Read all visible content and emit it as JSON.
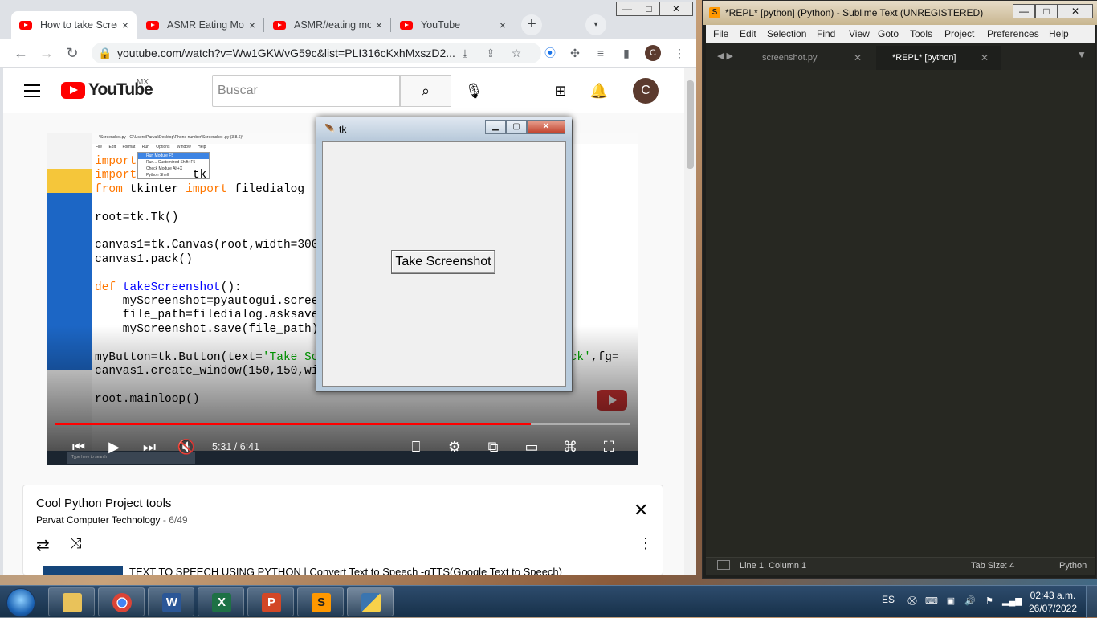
{
  "chrome": {
    "tabs": [
      {
        "title": "How to take Screenshot",
        "close": "×",
        "active": true
      },
      {
        "title": "ASMR Eating Mouth",
        "close": "×",
        "active": false
      },
      {
        "title": "ASMR//eating mouth",
        "close": "×",
        "active": false
      },
      {
        "title": "YouTube",
        "close": "×",
        "active": false
      }
    ],
    "new_tab": "+",
    "tab_search": "▾",
    "window_controls": {
      "minimize": "—",
      "maximize": "□",
      "close": "✕"
    },
    "url": "youtube.com/watch?v=Ww1GKWvG59c&list=PLI316cKxhMxszD2...",
    "profile_initial": "C",
    "icons": [
      "back-icon",
      "forward-icon",
      "reload-icon",
      "lock-icon",
      "download-icon",
      "share-icon",
      "star-icon",
      "extension-icon",
      "puzzle-icon",
      "media-icon",
      "sidepanel-icon",
      "menu-icon"
    ]
  },
  "youtube": {
    "logo_text": "YouTube",
    "country": "MX",
    "search_placeholder": "Buscar",
    "avatar_initial": "C",
    "video": {
      "time": "5:31 / 6:41",
      "progress_fraction": 0.8267
    },
    "idle_window": {
      "title": "*Screenshot.py - C:\\Users\\Parvat\\Desktop\\Phone number\\Screenshot .py (3.8.6)*",
      "menu": [
        "File",
        "Edit",
        "Format",
        "Run",
        "Options",
        "Window",
        "Help"
      ],
      "run_menu": [
        "Run Module     F5",
        "Run... Customized   Shift+F5",
        "Check Module    Alt+X",
        "Python Shell"
      ],
      "taskbar_search": "Type here to search"
    },
    "playlist": {
      "title": "Cool Python Project tools",
      "channel": "Parvat Computer Technology",
      "position": " - 6/49",
      "next_item": "TEXT TO SPEECH USING PYTHON | Convert Text to Speech -gTTS(Google Text to Speech)"
    }
  },
  "tk": {
    "title": "tk",
    "button_label": "Take Screenshot"
  },
  "sublime": {
    "title": "*REPL* [python] (Python) - Sublime Text (UNREGISTERED)",
    "menu": [
      "File",
      "Edit",
      "Selection",
      "Find",
      "View",
      "Goto",
      "Tools",
      "Project",
      "Preferences",
      "Help"
    ],
    "tabs": [
      {
        "label": "screenshot.py",
        "active": false
      },
      {
        "label": "*REPL* [python]",
        "active": true
      }
    ],
    "status": {
      "position": "Line 1, Column 1",
      "tab_size": "Tab Size: 4",
      "syntax": "Python"
    }
  },
  "taskbar": {
    "lang": "ES",
    "time": "02:43 a.m.",
    "date": "26/07/2022",
    "apps": [
      "explorer-icon",
      "chrome-icon",
      "word-icon",
      "excel-icon",
      "powerpoint-icon",
      "sublime-icon",
      "python-icon"
    ]
  }
}
